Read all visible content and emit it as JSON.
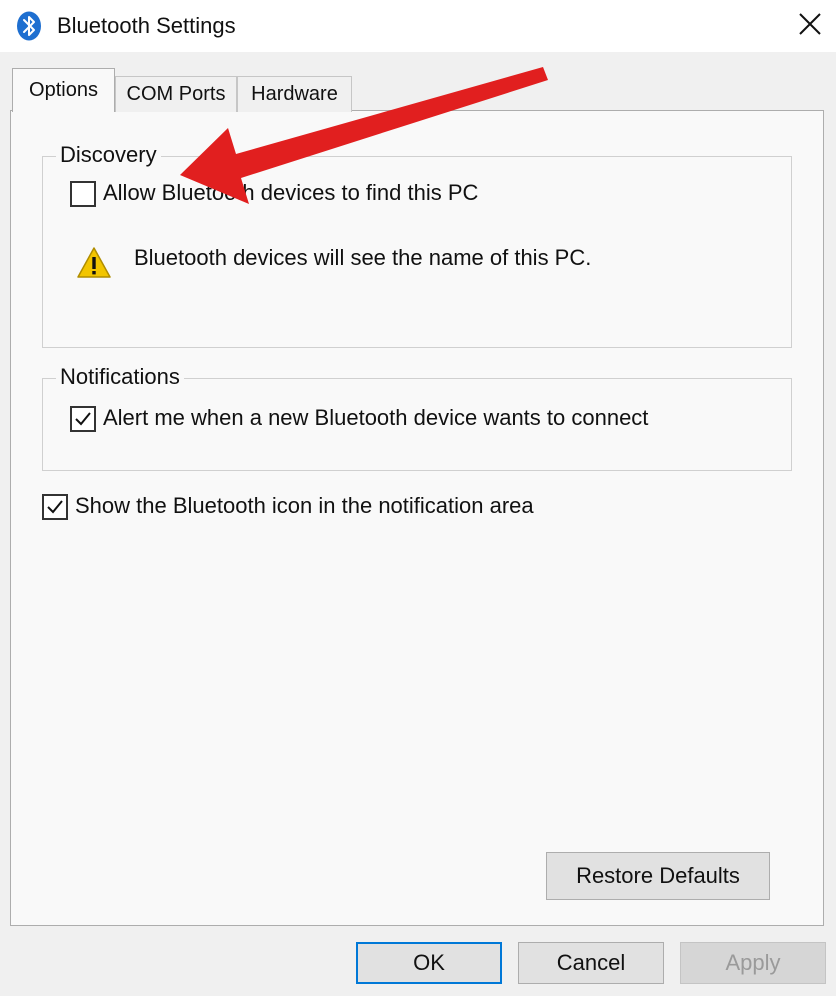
{
  "window": {
    "title": "Bluetooth Settings",
    "icon": "bluetooth-icon",
    "close_icon": "close-icon"
  },
  "tabs": [
    {
      "label": "Options",
      "active": true
    },
    {
      "label": "COM Ports",
      "active": false
    },
    {
      "label": "Hardware",
      "active": false
    }
  ],
  "discovery": {
    "legend": "Discovery",
    "allow_label": "Allow Bluetooth devices to find this PC",
    "allow_checked": false,
    "warning_text": "Bluetooth devices will see the name of this PC.",
    "warning_icon": "warning-icon"
  },
  "notifications": {
    "legend": "Notifications",
    "alert_label": "Alert me when a new Bluetooth device wants to connect",
    "alert_checked": true
  },
  "show_icon": {
    "label": "Show the Bluetooth icon in the notification area",
    "checked": true
  },
  "buttons": {
    "restore_defaults": "Restore Defaults",
    "ok": "OK",
    "cancel": "Cancel",
    "apply": "Apply"
  },
  "colors": {
    "accent": "#0078d7",
    "arrow": "#e11f1f",
    "warning": "#f2c500"
  }
}
